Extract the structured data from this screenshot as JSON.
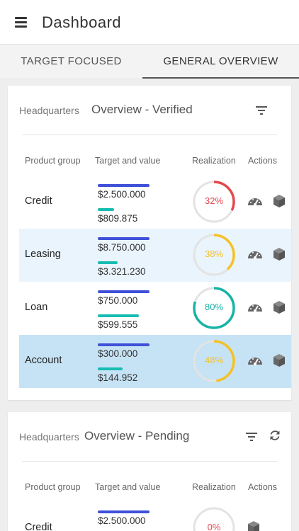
{
  "header": {
    "title": "Dashboard"
  },
  "tabs": [
    {
      "label": "TARGET FOCUSED",
      "active": false
    },
    {
      "label": "GENERAL OVERVIEW",
      "active": true
    }
  ],
  "colors": {
    "target_bar": "#3f51d8",
    "value_bar": "#17bdb2",
    "gauge_red": "#e5484d",
    "gauge_yellow": "#f5c125",
    "gauge_teal": "#17b3a6",
    "gauge_track": "#e3e3e3"
  },
  "icons": {
    "menu": "hamburger-menu",
    "filter": "filter-lines",
    "refresh": "refresh-arrows",
    "speedometer": "speedometer",
    "box": "cube-box"
  },
  "columns": {
    "product_group": "Product group",
    "target_value": "Target and value",
    "realization": "Realization",
    "actions": "Actions"
  },
  "cards": [
    {
      "location": "Headquarters",
      "title": "Overview - Verified",
      "rows": [
        {
          "product": "Credit",
          "target": "$2.500.000",
          "value": "$809.875",
          "realization": "32%",
          "realization_fraction": 0.32,
          "value_fraction": 0.32,
          "color": "#e5484d"
        },
        {
          "product": "Leasing",
          "target": "$8.750.000",
          "value": "$3.321.230",
          "realization": "38%",
          "realization_fraction": 0.38,
          "value_fraction": 0.38,
          "color": "#f5c125"
        },
        {
          "product": "Loan",
          "target": "$750.000",
          "value": "$599.555",
          "realization": "80%",
          "realization_fraction": 0.8,
          "value_fraction": 0.8,
          "color": "#17b3a6"
        },
        {
          "product": "Account",
          "target": "$300.000",
          "value": "$144.952",
          "realization": "48%",
          "realization_fraction": 0.48,
          "value_fraction": 0.48,
          "color": "#f5c125"
        }
      ]
    },
    {
      "location": "Headquarters",
      "title": "Overview - Pending",
      "rows": [
        {
          "product": "Credit",
          "target": "$2.500.000",
          "realization": "0%",
          "realization_fraction": 0.0,
          "color": "#e5484d"
        }
      ]
    }
  ]
}
